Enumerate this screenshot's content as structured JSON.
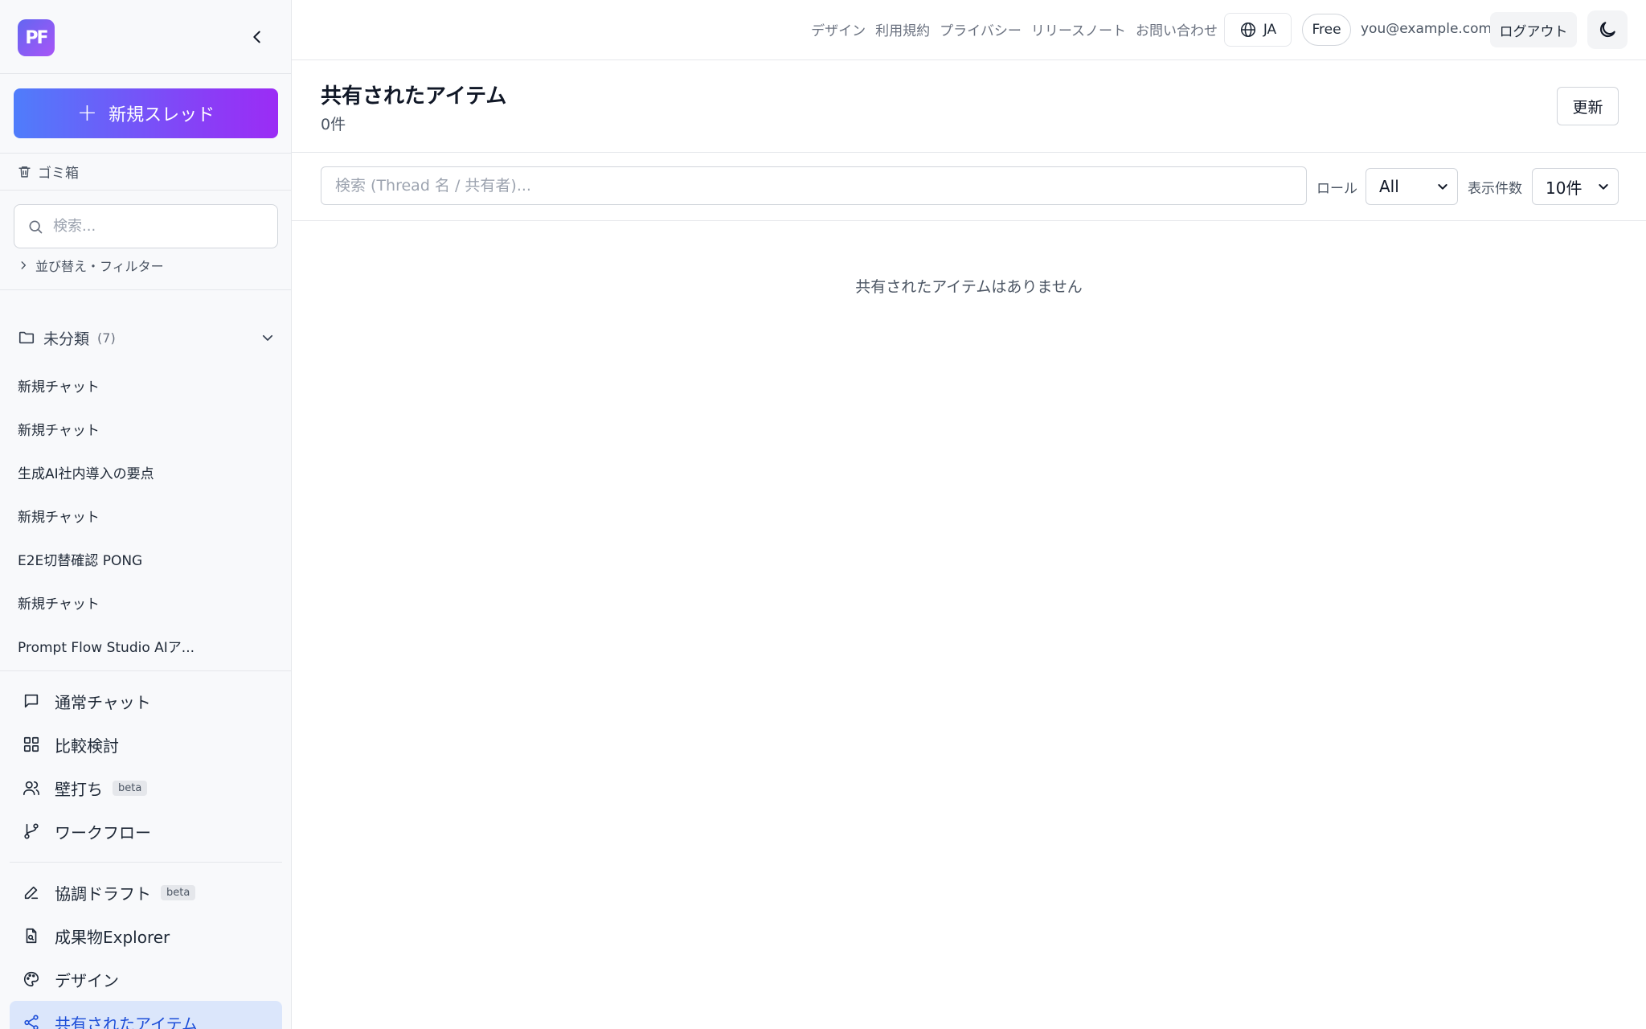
{
  "app": {
    "logo_text": "PF",
    "accent_gradient": [
      "#4f7dfb",
      "#9b2cf5"
    ]
  },
  "sidebar": {
    "new_thread_label": "新規スレッド",
    "trash_label": "ゴミ箱",
    "search_placeholder": "検索...",
    "sort_filter_label": "並び替え・フィルター",
    "folder": {
      "name": "未分類",
      "count": "(7)"
    },
    "threads": [
      "新規チャット",
      "新規チャット",
      "生成AI社内導入の要点",
      "新規チャット",
      "E2E切替確認 PONG",
      "新規チャット",
      "Prompt Flow Studio AIア..."
    ],
    "nav_primary": [
      {
        "label": "通常チャット",
        "icon": "message-square-icon"
      },
      {
        "label": "比較検討",
        "icon": "grid-icon"
      },
      {
        "label": "壁打ち",
        "icon": "users-icon",
        "badge": "beta"
      },
      {
        "label": "ワークフロー",
        "icon": "git-branch-icon"
      }
    ],
    "nav_secondary": [
      {
        "label": "協調ドラフト",
        "icon": "pencil-icon",
        "badge": "beta"
      },
      {
        "label": "成果物Explorer",
        "icon": "file-search-icon"
      },
      {
        "label": "デザイン",
        "icon": "palette-icon"
      },
      {
        "label": "共有されたアイテム",
        "icon": "share-icon",
        "active": true
      }
    ]
  },
  "topbar": {
    "links": [
      "デザイン",
      "利用規約",
      "プライバシー",
      "リリースノート",
      "お問い合わせ"
    ],
    "language": "JA",
    "plan": "Free",
    "email": "you@example.com",
    "logout_label": "ログアウト"
  },
  "main": {
    "title": "共有されたアイテム",
    "count": "0件",
    "refresh_label": "更新",
    "search_placeholder": "検索 (Thread 名 / 共有者)...",
    "role_label": "ロール",
    "role_value": "All",
    "per_page_label": "表示件数",
    "per_page_value": "10件",
    "empty_message": "共有されたアイテムはありません"
  }
}
